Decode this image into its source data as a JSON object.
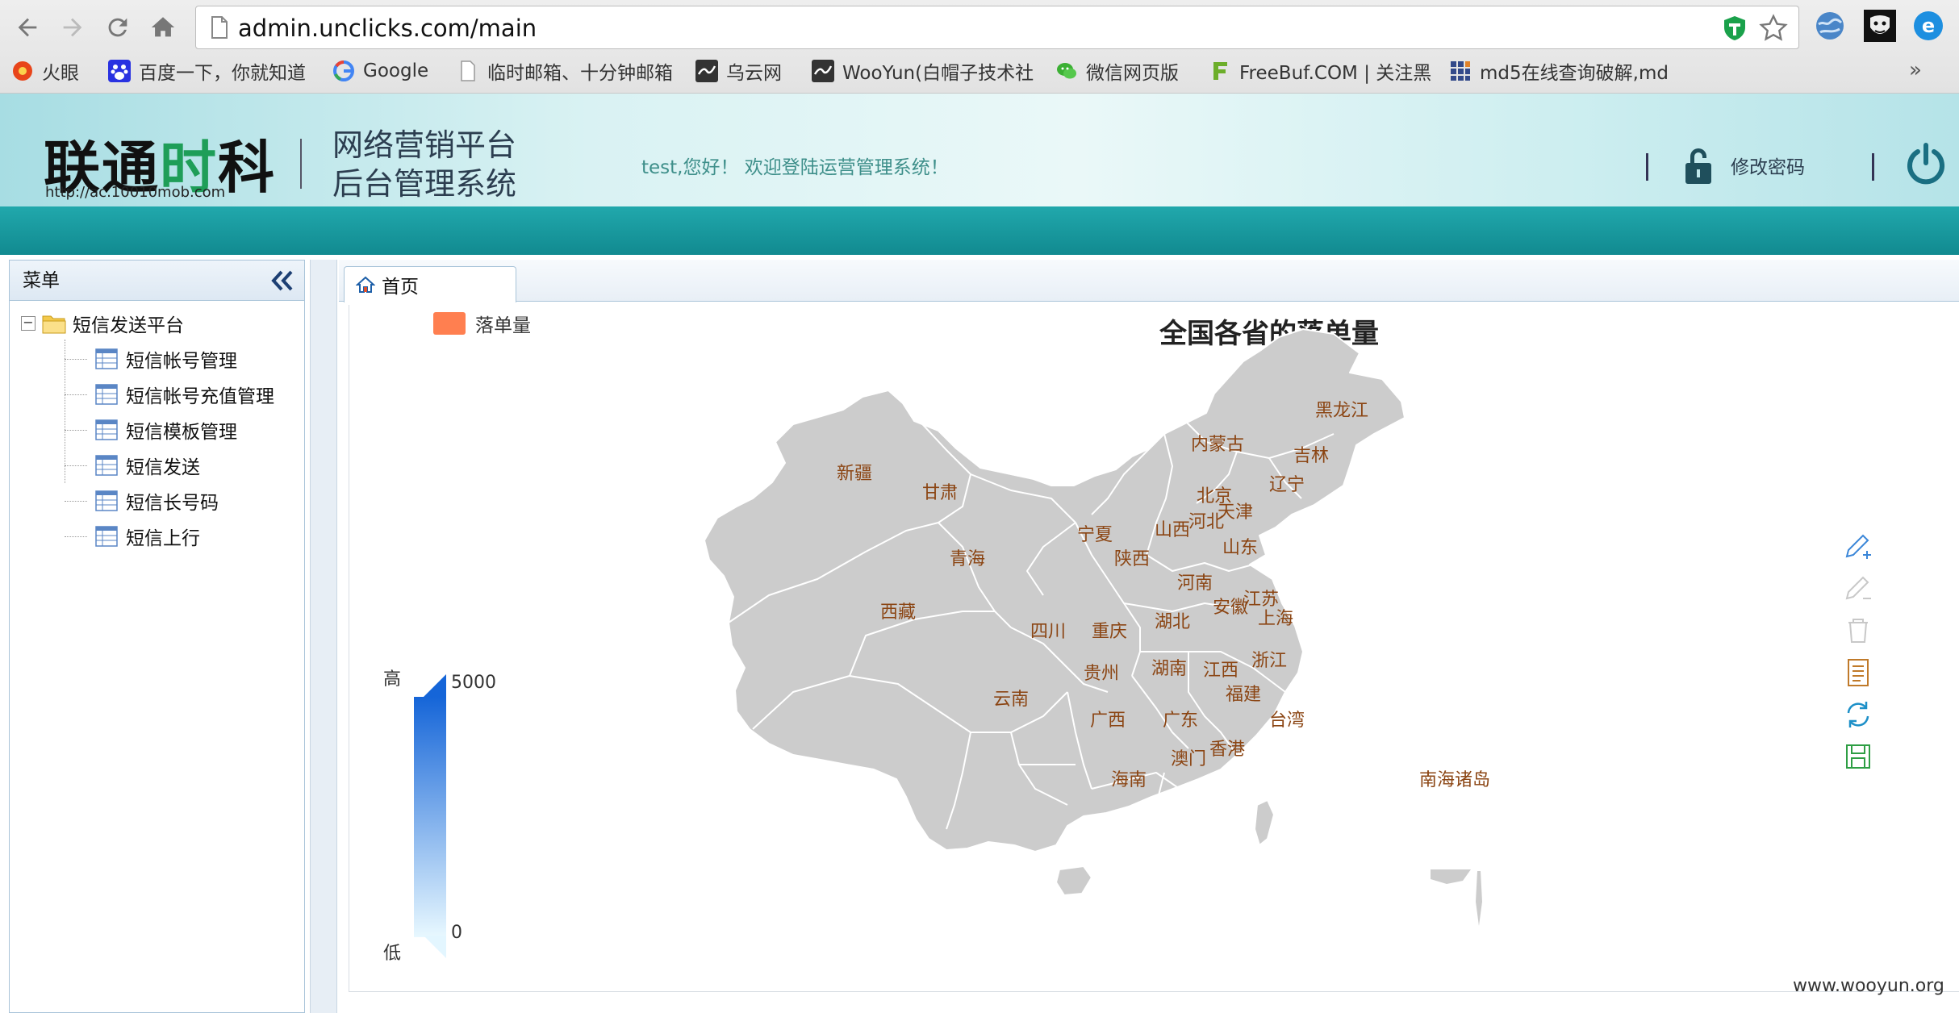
{
  "browser": {
    "url": "admin.unclicks.com/main",
    "bookmarks": [
      {
        "label": "火眼",
        "icon": "firefox-red-icon"
      },
      {
        "label": "百度一下，你就知道",
        "icon": "baidu-paw-icon"
      },
      {
        "label": "Google",
        "icon": "google-g-icon"
      },
      {
        "label": "临时邮箱、十分钟邮箱",
        "icon": "page-icon"
      },
      {
        "label": "乌云网",
        "icon": "wooyun-icon"
      },
      {
        "label": "WooYun(白帽子技术社",
        "icon": "wooyun-icon"
      },
      {
        "label": "微信网页版",
        "icon": "wechat-icon"
      },
      {
        "label": "FreeBuf.COM | 关注黑",
        "icon": "freebuf-icon"
      },
      {
        "label": "md5在线查询破解,md",
        "icon": "md5-grid-icon"
      }
    ],
    "more": "»"
  },
  "header": {
    "logo_black": "联通",
    "logo_green": "时",
    "logo_black2": "科",
    "logo_url": "http://ac.10010mob.com",
    "system_title": "网络营销平台\n后台管理系统",
    "welcome": "test,您好！ 欢迎登陆运营管理系统！",
    "change_password": "修改密码"
  },
  "sidebar": {
    "title": "菜单",
    "root": {
      "label": "短信发送平台",
      "toggle": "−"
    },
    "items": [
      {
        "label": "短信帐号管理"
      },
      {
        "label": "短信帐号充值管理"
      },
      {
        "label": "短信模板管理"
      },
      {
        "label": "短信发送"
      },
      {
        "label": "短信长号码"
      },
      {
        "label": "短信上行"
      }
    ]
  },
  "tabs": [
    {
      "label": "首页"
    }
  ],
  "chart_data": {
    "type": "map",
    "title": "全国各省的落单量",
    "legend": [
      {
        "name": "落单量",
        "color": "#ff7f50"
      }
    ],
    "visual_map": {
      "min": 0,
      "max": 5000,
      "high_label": "高",
      "low_label": "低",
      "max_text": "5000",
      "min_text": "0",
      "color_high": "#1565d8",
      "color_low": "#e8f8ff"
    },
    "map_fill": "#cccccc",
    "label_color": "#8b4513",
    "regions": [
      "黑龙江",
      "内蒙古",
      "吉林",
      "新疆",
      "辽宁",
      "甘肃",
      "北京",
      "天津",
      "河北",
      "宁夏",
      "山西",
      "山东",
      "青海",
      "陕西",
      "河南",
      "江苏",
      "西藏",
      "安徽",
      "上海",
      "四川",
      "重庆",
      "湖北",
      "浙江",
      "贵州",
      "湖南",
      "江西",
      "福建",
      "云南",
      "广西",
      "广东",
      "台湾",
      "香港",
      "澳门",
      "海南",
      "南海诸岛"
    ]
  },
  "watermark": "www.wooyun.org"
}
